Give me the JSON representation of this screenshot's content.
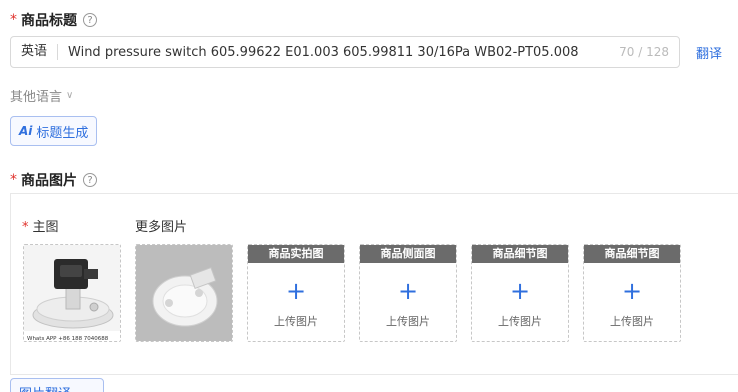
{
  "title_section": {
    "label": "商品标题",
    "required_mark": "*",
    "language_tag": "英语",
    "title_value": "Wind pressure switch 605.99622 E01.003 605.99811 30/16Pa WB02-PT05.008",
    "char_count": "70 / 128",
    "translate_link": "翻译",
    "other_languages": "其他语言",
    "ai_button": {
      "icon_text": "Ai",
      "label": "标题生成"
    }
  },
  "image_section": {
    "label": "商品图片",
    "required_mark": "*",
    "main_image_label": "主图",
    "more_images_label": "更多图片",
    "main_image_caption": "Whats APP +86 188 7040688",
    "upload_cards": [
      {
        "title": "商品实拍图",
        "action": "上传图片"
      },
      {
        "title": "商品侧面图",
        "action": "上传图片"
      },
      {
        "title": "商品细节图",
        "action": "上传图片"
      },
      {
        "title": "商品细节图",
        "action": "上传图片"
      }
    ],
    "bottom_button": "图片翻译"
  },
  "colors": {
    "accent": "#2f6fde",
    "required": "#e0312b",
    "card_header": "#6b6b6b"
  }
}
